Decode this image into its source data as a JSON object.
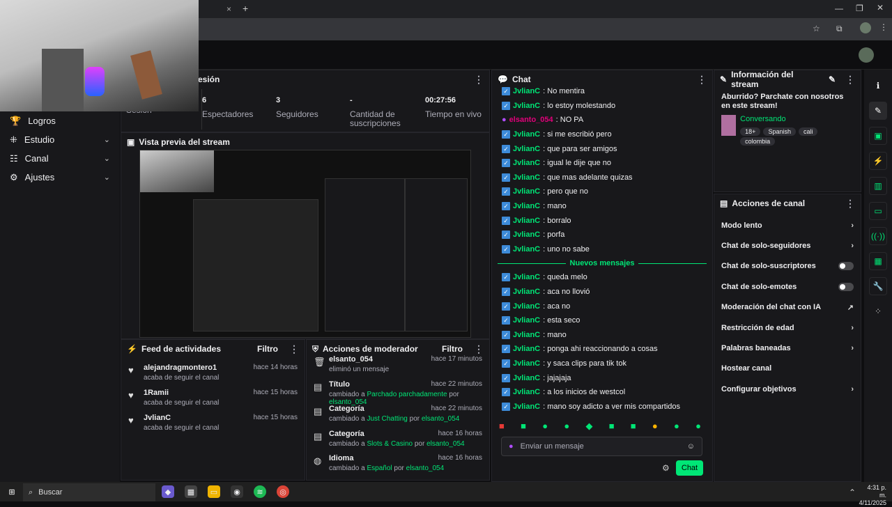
{
  "browser": {
    "new_tab": "+",
    "close_tab": "×"
  },
  "stats": [
    {
      "label": "Sesión",
      "value": ""
    },
    {
      "label": "Espectadores",
      "value": "6"
    },
    {
      "label": "Seguidores",
      "value": "3"
    },
    {
      "label": "Cantidad de suscripciones",
      "value": "-"
    },
    {
      "label": "Tiempo en vivo",
      "value": "00:27:56"
    }
  ],
  "sesion_header": "esión",
  "sidebar": {
    "items": [
      {
        "label": "Logros",
        "expandable": false
      },
      {
        "label": "Estudio",
        "expandable": true
      },
      {
        "label": "Canal",
        "expandable": true
      },
      {
        "label": "Ajustes",
        "expandable": true
      }
    ]
  },
  "preview": {
    "title": "Vista previa del stream"
  },
  "feed": {
    "title": "Feed de actividades",
    "filter": "Filtro",
    "items": [
      {
        "name": "alejandragmontero1",
        "text": "acaba de seguir el canal",
        "time": "hace 14 horas"
      },
      {
        "name": "1Ramii",
        "text": "acaba de seguir el canal",
        "time": "hace 15 horas"
      },
      {
        "name": "JvlianC",
        "text": "acaba de seguir el canal",
        "time": "hace 15 horas"
      }
    ]
  },
  "mod": {
    "title": "Acciones de moderador",
    "filter": "Filtro",
    "items": [
      {
        "name": "elsanto_054",
        "pre": "eliminó un mensaje",
        "val": "",
        "by": "",
        "user": "",
        "time": "hace 17 minutos"
      },
      {
        "name": "Título",
        "pre": "cambiado a",
        "val": "Parchado parchadamente",
        "by": "por",
        "user": "elsanto_054",
        "time": "hace 22 minutos"
      },
      {
        "name": "Categoría",
        "pre": "cambiado a",
        "val": "Just Chatting",
        "by": "por",
        "user": "elsanto_054",
        "time": "hace 22 minutos"
      },
      {
        "name": "Categoría",
        "pre": "cambiado a",
        "val": "Slots & Casino",
        "by": "por",
        "user": "elsanto_054",
        "time": "hace 16 horas"
      },
      {
        "name": "Idioma",
        "pre": "cambiado a",
        "val": "Español",
        "by": "por",
        "user": "elsanto_054",
        "time": "hace 16 horas"
      }
    ]
  },
  "chat": {
    "title": "Chat",
    "messages_before": [
      {
        "user": "JvlianC",
        "text": ": No mentira"
      },
      {
        "user": "JvlianC",
        "text": ": lo estoy molestando"
      },
      {
        "user": "elsanto_054",
        "text": ": NO PA",
        "broadcaster": true
      },
      {
        "user": "JvlianC",
        "text": ": si me escribió pero"
      },
      {
        "user": "JvlianC",
        "text": ": que para ser amigos"
      },
      {
        "user": "JvlianC",
        "text": ": igual le dije que no"
      },
      {
        "user": "JvlianC",
        "text": ": que mas adelante quizas"
      },
      {
        "user": "JvlianC",
        "text": ": pero que no"
      },
      {
        "user": "JvlianC",
        "text": ": mano"
      },
      {
        "user": "JvlianC",
        "text": ": borralo"
      },
      {
        "user": "JvlianC",
        "text": ": porfa"
      },
      {
        "user": "JvlianC",
        "text": ": uno no sabe"
      }
    ],
    "new_messages_label": "Nuevos mensajes",
    "messages_after": [
      {
        "user": "JvlianC",
        "text": ": queda melo"
      },
      {
        "user": "JvlianC",
        "text": ": aca no llovió"
      },
      {
        "user": "JvlianC",
        "text": ": aca no"
      },
      {
        "user": "JvlianC",
        "text": ": esta seco"
      },
      {
        "user": "JvlianC",
        "text": ": mano"
      },
      {
        "user": "JvlianC",
        "text": ": ponga ahi reaccionando a cosas"
      },
      {
        "user": "JvlianC",
        "text": ": y saca clips para tik tok"
      },
      {
        "user": "JvlianC",
        "text": ": jajajaja"
      },
      {
        "user": "JvlianC",
        "text": ": a los inicios de westcol"
      },
      {
        "user": "JvlianC",
        "text": ": mano soy adicto a ver mis compartidos"
      }
    ],
    "input_placeholder": "Enviar un mensaje",
    "send_label": "Chat"
  },
  "info": {
    "title": "Información del stream",
    "stream_title": "Aburrido? Parchate con nosotros en este stream!",
    "category": "Conversando",
    "tags": [
      "18+",
      "Spanish",
      "cali",
      "colombia"
    ]
  },
  "actions": {
    "title": "Acciones de canal",
    "items": [
      {
        "label": "Modo lento",
        "control": "arrow"
      },
      {
        "label": "Chat de solo-seguidores",
        "control": "arrow"
      },
      {
        "label": "Chat de solo-suscriptores",
        "control": "toggle"
      },
      {
        "label": "Chat de solo-emotes",
        "control": "toggle"
      },
      {
        "label": "Moderación del chat con IA",
        "control": "external"
      },
      {
        "label": "Restricción de edad",
        "control": "arrow"
      },
      {
        "label": "Palabras baneadas",
        "control": "arrow"
      },
      {
        "label": "Hostear canal",
        "control": "none"
      },
      {
        "label": "Configurar objetivos",
        "control": "arrow"
      }
    ]
  },
  "taskbar": {
    "search": "Buscar",
    "time": "4:31 p. m.",
    "date": "4/11/2025"
  }
}
